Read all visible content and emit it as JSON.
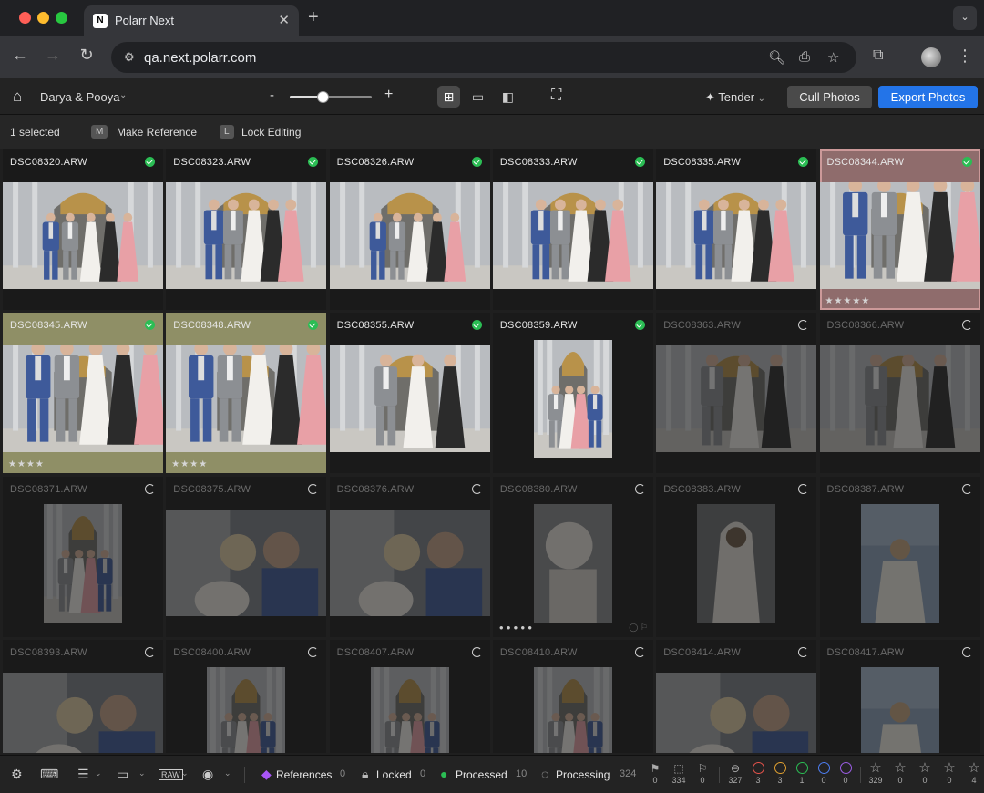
{
  "browser": {
    "tab_title": "Polarr Next",
    "favicon_text": "N",
    "url": "qa.next.polarr.com"
  },
  "toolbar": {
    "album_name": "Darya & Pooya",
    "zoom_level": 0.4,
    "ai_style": "Tender",
    "cull_label": "Cull Photos",
    "export_label": "Export Photos"
  },
  "selection": {
    "count_label": "1 selected",
    "make_reference_key": "M",
    "make_reference_label": "Make Reference",
    "lock_editing_key": "L",
    "lock_editing_label": "Lock Editing"
  },
  "photos": [
    {
      "name": "DSC08320.ARW",
      "status": "done",
      "tint": "",
      "stars": 0,
      "thumb": "group-wide"
    },
    {
      "name": "DSC08323.ARW",
      "status": "done",
      "tint": "",
      "stars": 0,
      "thumb": "group-close"
    },
    {
      "name": "DSC08326.ARW",
      "status": "done",
      "tint": "",
      "stars": 0,
      "thumb": "group-wide"
    },
    {
      "name": "DSC08333.ARW",
      "status": "done",
      "tint": "",
      "stars": 0,
      "thumb": "group-close"
    },
    {
      "name": "DSC08335.ARW",
      "status": "done",
      "tint": "",
      "stars": 0,
      "thumb": "group-close"
    },
    {
      "name": "DSC08344.ARW",
      "status": "done",
      "tint": "rose",
      "stars": 5,
      "thumb": "group-tight"
    },
    {
      "name": "DSC08345.ARW",
      "status": "done",
      "tint": "olive",
      "stars": 4,
      "thumb": "group-tight"
    },
    {
      "name": "DSC08348.ARW",
      "status": "done",
      "tint": "olive",
      "stars": 4,
      "thumb": "group-tight"
    },
    {
      "name": "DSC08355.ARW",
      "status": "done",
      "tint": "",
      "stars": 0,
      "thumb": "couple-wide"
    },
    {
      "name": "DSC08359.ARW",
      "status": "done",
      "tint": "",
      "stars": 0,
      "thumb": "tall-group"
    },
    {
      "name": "DSC08363.ARW",
      "status": "loading",
      "tint": "",
      "stars": 0,
      "thumb": "couple-wide"
    },
    {
      "name": "DSC08366.ARW",
      "status": "loading",
      "tint": "",
      "stars": 0,
      "thumb": "couple-wide"
    },
    {
      "name": "DSC08371.ARW",
      "status": "loading",
      "tint": "",
      "stars": 0,
      "thumb": "tall-group"
    },
    {
      "name": "DSC08375.ARW",
      "status": "loading",
      "tint": "",
      "stars": 0,
      "thumb": "closeup"
    },
    {
      "name": "DSC08376.ARW",
      "status": "loading",
      "tint": "",
      "stars": 0,
      "thumb": "closeup"
    },
    {
      "name": "DSC08380.ARW",
      "status": "loading",
      "tint": "",
      "stars": 0,
      "thumb": "tall-flowers",
      "dots": true
    },
    {
      "name": "DSC08383.ARW",
      "status": "loading",
      "tint": "",
      "stars": 0,
      "thumb": "tall-veil"
    },
    {
      "name": "DSC08387.ARW",
      "status": "loading",
      "tint": "",
      "stars": 0,
      "thumb": "tall-back"
    },
    {
      "name": "DSC08393.ARW",
      "status": "loading",
      "tint": "",
      "stars": 0,
      "thumb": "closeup"
    },
    {
      "name": "DSC08400.ARW",
      "status": "loading",
      "tint": "",
      "stars": 0,
      "thumb": "tall-group"
    },
    {
      "name": "DSC08407.ARW",
      "status": "loading",
      "tint": "",
      "stars": 0,
      "thumb": "tall-group"
    },
    {
      "name": "DSC08410.ARW",
      "status": "loading",
      "tint": "",
      "stars": 0,
      "thumb": "tall-group"
    },
    {
      "name": "DSC08414.ARW",
      "status": "loading",
      "tint": "",
      "stars": 0,
      "thumb": "closeup"
    },
    {
      "name": "DSC08417.ARW",
      "status": "loading",
      "tint": "",
      "stars": 0,
      "thumb": "tall-back"
    }
  ],
  "status_bar": {
    "references_label": "References",
    "references_count": "0",
    "locked_label": "Locked",
    "locked_count": "0",
    "processed_label": "Processed",
    "processed_count": "10",
    "processing_label": "Processing",
    "processing_count": "324",
    "flag_counts": [
      "0",
      "334",
      "0"
    ],
    "reject_count": "327",
    "color_labels": [
      {
        "color": "#e5534b",
        "count": "3"
      },
      {
        "color": "#e0a030",
        "count": "3"
      },
      {
        "color": "#2bbd54",
        "count": "1"
      },
      {
        "color": "#4d7ef0",
        "count": "0"
      },
      {
        "color": "#9b5de5",
        "count": "0"
      }
    ],
    "star_counts": [
      "329",
      "0",
      "0",
      "0",
      "4"
    ]
  },
  "colors": {
    "accent": "#2374e8",
    "processed": "#2bbd54",
    "reference": "#a855f7"
  }
}
